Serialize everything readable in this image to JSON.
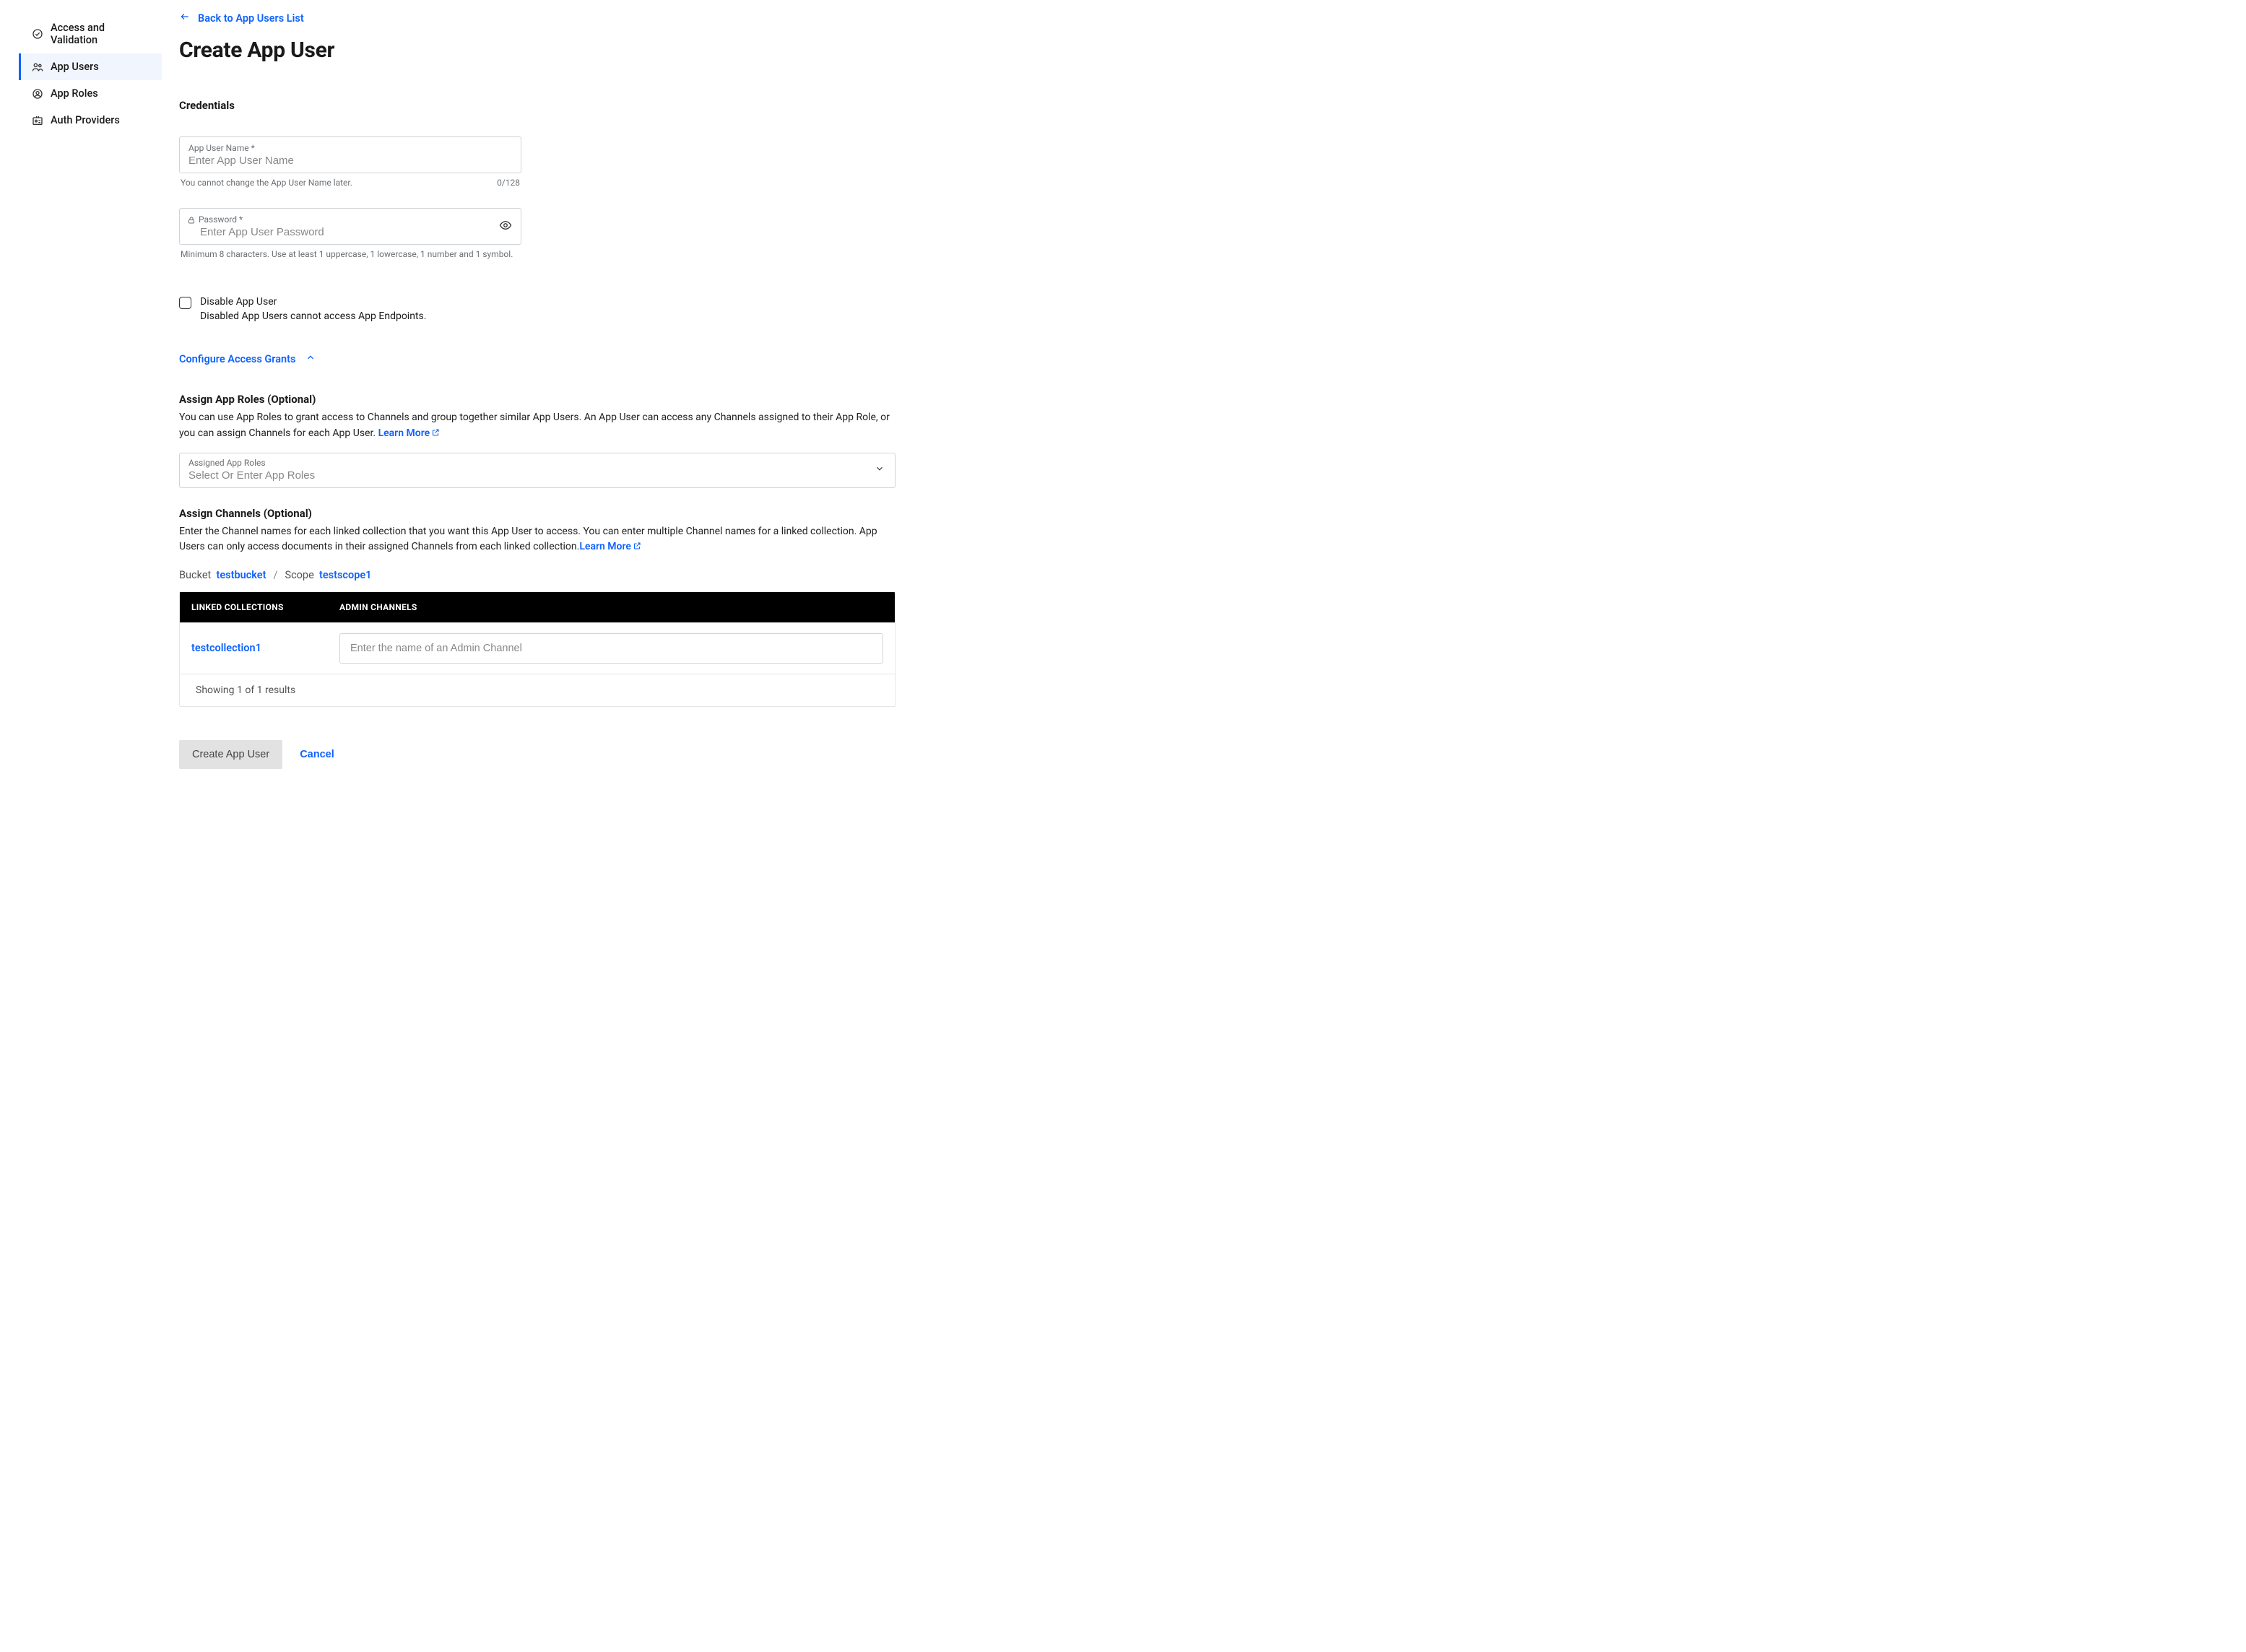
{
  "sidebar": {
    "items": [
      {
        "label": "Access and Validation",
        "icon": "check-circle-icon",
        "active": false
      },
      {
        "label": "App Users",
        "icon": "users-icon",
        "active": true
      },
      {
        "label": "App Roles",
        "icon": "user-circle-icon",
        "active": false
      },
      {
        "label": "Auth Providers",
        "icon": "id-card-icon",
        "active": false
      }
    ]
  },
  "header": {
    "back_label": "Back to App Users List",
    "title": "Create App User"
  },
  "credentials": {
    "title": "Credentials",
    "username_label": "App User Name *",
    "username_placeholder": "Enter App User Name",
    "username_helper": "You cannot change the App User Name later.",
    "username_counter": "0/128",
    "password_label": "Password *",
    "password_placeholder": "Enter App User Password",
    "password_helper": "Minimum 8 characters. Use at least 1 uppercase, 1 lowercase, 1 number and 1 symbol.",
    "disable_title": "Disable App User",
    "disable_desc": "Disabled App Users cannot access App Endpoints."
  },
  "grants": {
    "toggle_label": "Configure Access Grants"
  },
  "roles": {
    "title": "Assign App Roles (Optional)",
    "desc": "You can use App Roles to grant access to Channels and group together similar App Users. An App User can access any Channels assigned to their App Role, or you can assign Channels for each App User. ",
    "learn_more": "Learn More",
    "field_label": "Assigned App Roles",
    "placeholder": "Select Or Enter App Roles"
  },
  "channels": {
    "title": "Assign Channels (Optional)",
    "desc": "Enter the Channel names for each linked collection that you want this App User to access. You can enter multiple Channel names for a linked collection. App Users can only access documents in their assigned Channels from each linked collection.",
    "learn_more": "Learn More",
    "bucket_label": "Bucket",
    "bucket_value": "testbucket",
    "scope_label": "Scope",
    "scope_value": "testscope1",
    "col_linked": "LINKED COLLECTIONS",
    "col_admin": "ADMIN CHANNELS",
    "rows": [
      {
        "collection": "testcollection1",
        "placeholder": "Enter the name of an Admin Channel"
      }
    ],
    "results": "Showing 1 of 1 results"
  },
  "footer": {
    "create": "Create App User",
    "cancel": "Cancel"
  }
}
